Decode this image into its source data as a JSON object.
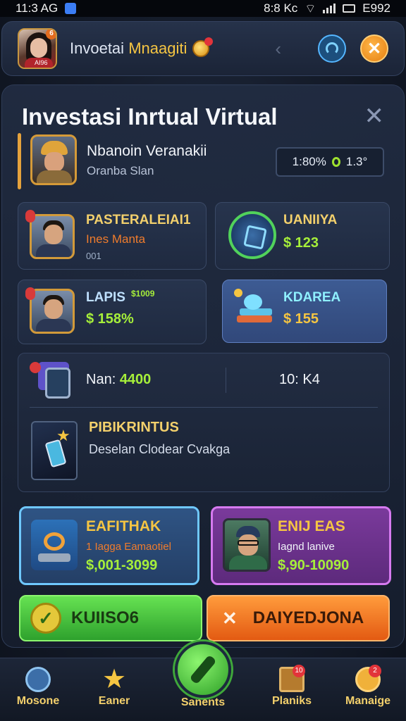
{
  "status_bar": {
    "time": "11:3 AG",
    "network": "8:8 Kc",
    "battery": "E992"
  },
  "header": {
    "title_part1": "Invoetai",
    "title_part2": "Mnaagiti",
    "avatar_caption": "AI96"
  },
  "page": {
    "title": "Investasi Inrtual Virtual"
  },
  "profile": {
    "name": "Nbanoin Veranakii",
    "subtitle": "Oranba Slan",
    "stat_percent": "1:80%",
    "stat_value": "1.3°"
  },
  "cards": [
    {
      "title": "PASTERALEIAI1",
      "line1": "Ines Manta",
      "line2": "001"
    },
    {
      "title": "UANIIYA",
      "value": "$ 123"
    },
    {
      "title": "LAPIS",
      "badge": "$1009",
      "value": "$ 158%"
    },
    {
      "title": "KDAREA",
      "value": "$ 155"
    }
  ],
  "combo": {
    "metric_left_label": "Nan:",
    "metric_left_value": "4400",
    "metric_right": "10: K4",
    "title": "PIBIKRINTUS",
    "description": "Deselan Clodear Cvakga"
  },
  "big_cards": [
    {
      "title": "EAFITHAK",
      "subtitle": "1 Iagga Eamaotiel",
      "value": "$,001-3099",
      "title_color": "#f5c542",
      "subtitle_color": "#f07c2c"
    },
    {
      "title": "ENIJ EAS",
      "subtitle": "Iagnd lanive",
      "value": "$,90-10090",
      "title_color": "#f5c542",
      "subtitle_color": "#f1f4f9"
    }
  ],
  "actions": {
    "primary": "KUIISO6",
    "secondary": "DAIYEDJONA"
  },
  "nav": [
    {
      "label": "Mosone",
      "icon": "compass-icon"
    },
    {
      "label": "Eaner",
      "icon": "star-icon"
    },
    {
      "label": "Sanents",
      "icon": "brush-icon"
    },
    {
      "label": "Planiks",
      "icon": "house-icon",
      "badge": "10"
    },
    {
      "label": "Manaige",
      "icon": "bot-icon",
      "badge": "2"
    }
  ],
  "colors": {
    "accent": "#f5c542",
    "positive": "#a6ef3a",
    "primary_button": "#3fbf35",
    "secondary_button": "#f07c2c"
  }
}
